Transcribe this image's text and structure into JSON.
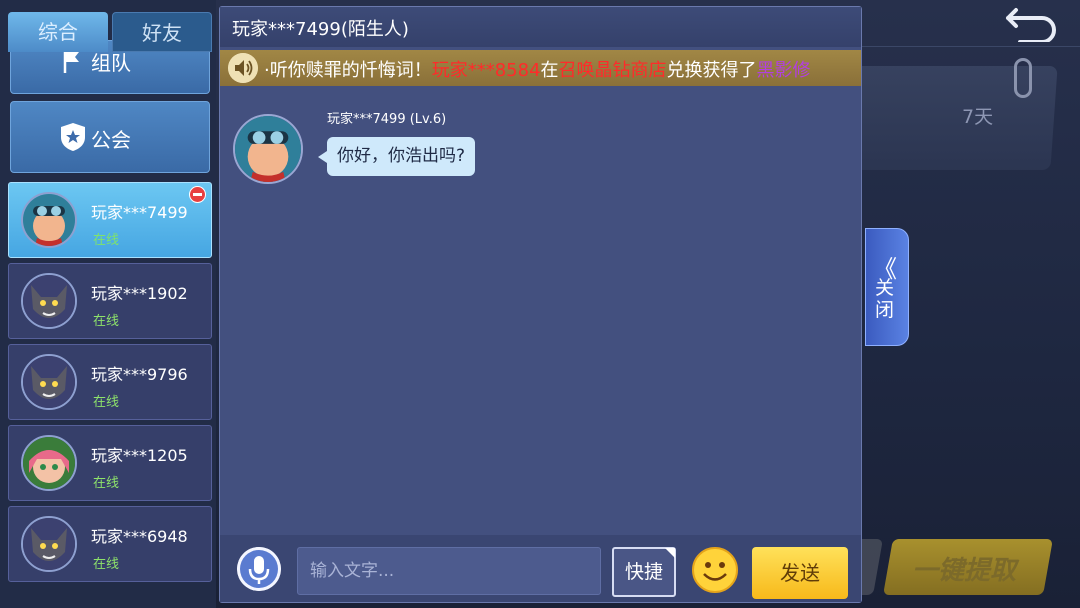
{
  "tabs": [
    {
      "label": "综合"
    },
    {
      "label": "好友"
    }
  ],
  "categories": {
    "team": "组队",
    "guild": "公会"
  },
  "friends": [
    {
      "name": "玩家***7499",
      "status": "在线"
    },
    {
      "name": "玩家***1902",
      "status": "在线"
    },
    {
      "name": "玩家***9796",
      "status": "在线"
    },
    {
      "name": "玩家***1205",
      "status": "在线"
    },
    {
      "name": "玩家***6948",
      "status": "在线"
    }
  ],
  "chat": {
    "title_name": "玩家***7499",
    "title_suffix": "(陌生人)",
    "announcement": {
      "prefix": "·听你赎罪的忏悔词！",
      "player": "玩家***8584",
      "mid": "在",
      "shop": "召唤晶钻商店",
      "mid2": "兑换获得了",
      "item": "黑影修"
    },
    "message": {
      "sender": "玩家***7499",
      "level": "(Lv.6)",
      "text": "你好，你浩出吗?"
    },
    "input_placeholder": "输入文字...",
    "quick_label": "快捷",
    "send_label": "发送"
  },
  "close_tab": {
    "chevron": "《",
    "label": "关闭"
  },
  "background": {
    "mail_days": "7天",
    "claim_all": "一键提取"
  },
  "colors": {
    "online": "#8ee36a",
    "send_button": "#f7b91a",
    "announce_red": "#ff2a2a",
    "announce_purple": "#b23fe0"
  },
  "icons": [
    "back-arrow-icon",
    "paperclip-icon",
    "flag-icon",
    "shield-icon",
    "remove-icon",
    "speaker-icon",
    "microphone-icon",
    "smiley-icon"
  ]
}
